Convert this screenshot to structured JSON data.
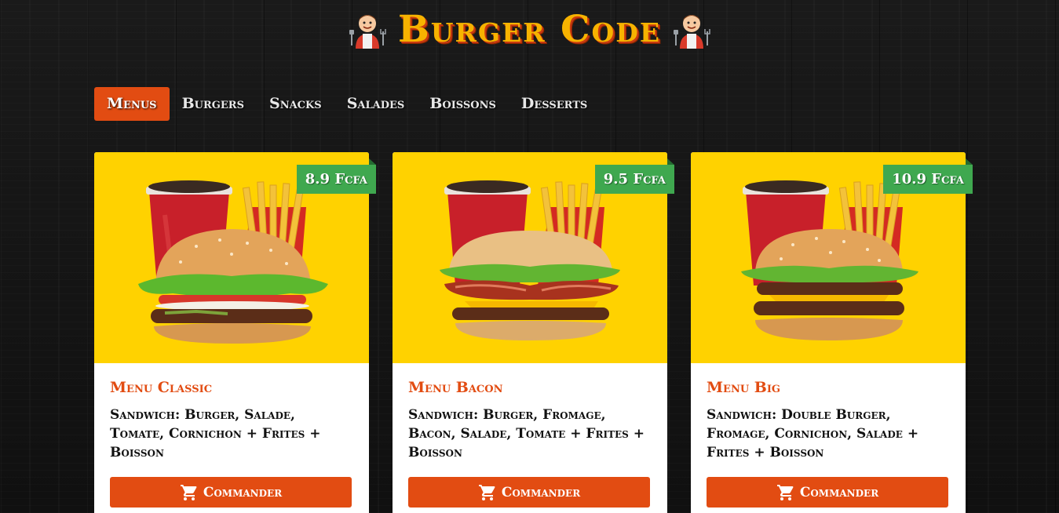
{
  "site": {
    "title": "Burger Code"
  },
  "nav": {
    "tabs": [
      {
        "label": "Menus",
        "active": true
      },
      {
        "label": "Burgers",
        "active": false
      },
      {
        "label": "Snacks",
        "active": false
      },
      {
        "label": "Salades",
        "active": false
      },
      {
        "label": "Boissons",
        "active": false
      },
      {
        "label": "Desserts",
        "active": false
      }
    ]
  },
  "products": [
    {
      "price": "8.9 Fcfa",
      "name": "Menu Classic",
      "description": "Sandwich: Burger, Salade, Tomate, Cornichon + Frites + Boisson",
      "button_label": "Commander",
      "image_icon": "classic-menu-photo"
    },
    {
      "price": "9.5 Fcfa",
      "name": "Menu Bacon",
      "description": "Sandwich: Burger, Fromage, Bacon, Salade, Tomate + Frites + Boisson",
      "button_label": "Commander",
      "image_icon": "bacon-menu-photo"
    },
    {
      "price": "10.9 Fcfa",
      "name": "Menu Big",
      "description": "Sandwich: Double Burger, Fromage, Cornichon, Salade + Frites + Boisson",
      "button_label": "Commander",
      "image_icon": "big-menu-photo"
    }
  ],
  "colors": {
    "accent": "#e24c12",
    "title": "#f7b300",
    "price_badge": "#3fa84f",
    "image_background": "#ffd200"
  }
}
